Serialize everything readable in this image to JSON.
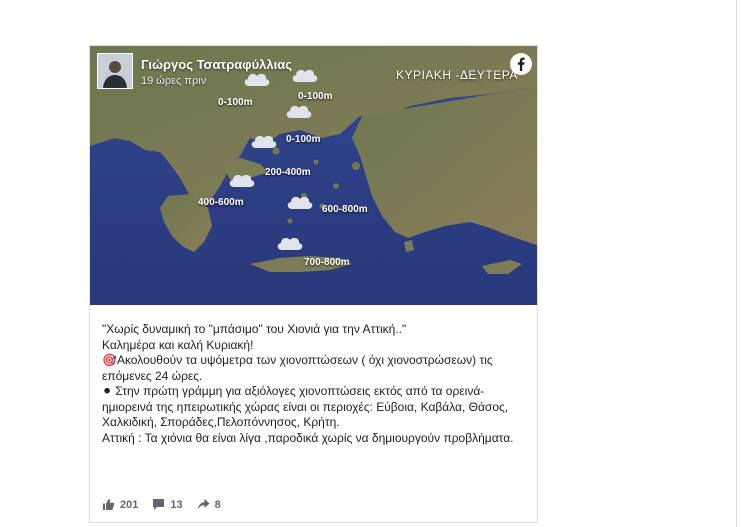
{
  "post": {
    "author": "Γιώργος Τσατραφύλλιας",
    "time": "19 ώρες πριν",
    "map_banner": "ΚΥΡΙΑΚΗ -ΔΕΥΤΕΡΑ",
    "elevations": [
      "0-100m",
      "0-100m",
      "0-100m",
      "200-400m",
      "400-600m",
      "600-800m",
      "700-800m"
    ],
    "text_lines": [
      "\"Χωρίς δυναμική το \"μπάσιμο\" του Χιονιά για την Αττική..\"",
      "Καλημέρα και καλή Κυριακή!",
      "🎯Ακολουθούν τα υψόμετρα των χιονοπτώσεων ( όχι χιονοστρώσεων) τις επόμενες 24 ώρες.",
      "⚫ Στην πρώτη γράμμη για αξιόλογες χιονοπτώσεις εκτός από τα ορεινά-ημιορεινά της ηπειρωτικής χώρας είναι οι περιοχές: Εύβοια, Καβάλα, Θάσος, Χαλκιδική, Σποράδες,Πελοπόννησος, Κρήτη.",
      "Αττική : Τα χιόνια θα είναι λίγα ,παροδικά χωρίς να δημιουργούν προβλήματα."
    ],
    "stats": {
      "likes": "201",
      "comments": "13",
      "shares": "8"
    }
  },
  "colors": {
    "sea": "#2e3f86",
    "land": "#6f7a4e",
    "text": "#1c1e21",
    "muted": "#606770",
    "fb_blue": "#1877f2"
  }
}
